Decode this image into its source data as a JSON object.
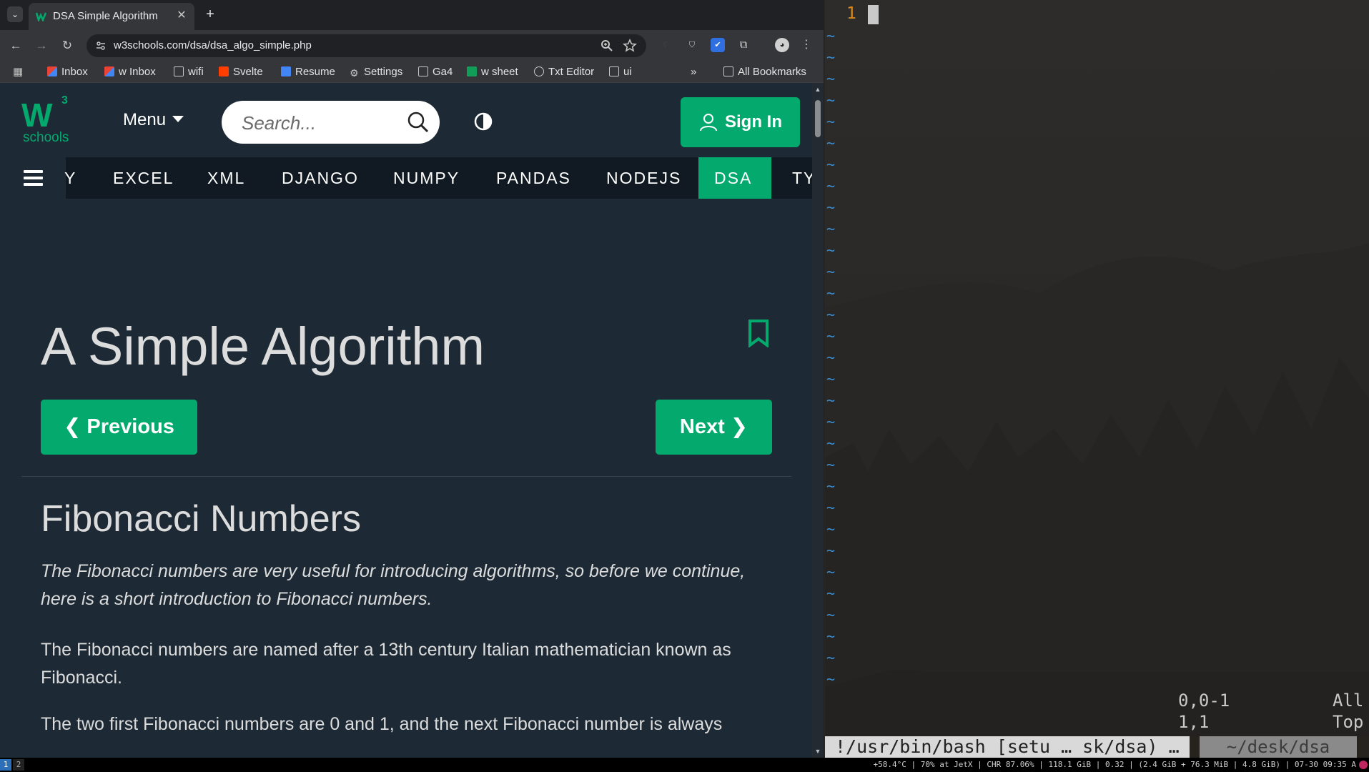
{
  "browser": {
    "tab": {
      "title": "DSA Simple Algorithm",
      "close_glyph": "✕"
    },
    "new_tab_glyph": "+",
    "tab_menu_glyph": "⌄",
    "nav": {
      "back": "←",
      "forward": "→",
      "reload": "↻"
    },
    "address": {
      "url": "w3schools.com/dsa/dsa_algo_simple.php"
    },
    "bookmarks": [
      {
        "label": "Inbox",
        "icon": "gmail-icon"
      },
      {
        "label": "w Inbox",
        "icon": "gmail-icon"
      },
      {
        "label": "wifi",
        "icon": "folder-icon"
      },
      {
        "label": "Svelte",
        "icon": "svelte-icon"
      },
      {
        "label": "Resume",
        "icon": "docs-icon"
      },
      {
        "label": "Settings",
        "icon": "gear-icon"
      },
      {
        "label": "Ga4",
        "icon": "folder-icon"
      },
      {
        "label": "w sheet",
        "icon": "sheets-icon"
      },
      {
        "label": "Txt Editor",
        "icon": "globe-icon"
      },
      {
        "label": "ui",
        "icon": "folder-icon"
      }
    ],
    "bookmarks_overflow": "»",
    "all_bookmarks": "All Bookmarks"
  },
  "page": {
    "logo": {
      "mark": "W",
      "superscript": "3",
      "word": "schools"
    },
    "menu_label": "Menu",
    "search_placeholder": "Search...",
    "signin_label": "Sign In",
    "subnav": [
      "Y",
      "EXCEL",
      "XML",
      "DJANGO",
      "NUMPY",
      "PANDAS",
      "NODEJS",
      "DSA",
      "TY"
    ],
    "subnav_active": "DSA",
    "title": "A Simple Algorithm",
    "prev_label": "❮ Previous",
    "next_label": "Next ❯",
    "section_title": "Fibonacci Numbers",
    "intro_italic": "The Fibonacci numbers are very useful for introducing algorithms, so before we continue, here is a short introduction to Fibonacci numbers.",
    "para_named": "The Fibonacci numbers are named after a 13th century Italian mathematician known as Fibonacci.",
    "para_cut": "The two first Fibonacci numbers are 0 and 1, and the next Fibonacci number is always"
  },
  "vim": {
    "line_number": "1",
    "ruler_pos_a": "0,0-1",
    "ruler_pos_b": "1,1",
    "ruler_view_a": "All",
    "ruler_view_b": "Top",
    "status_left": "!/usr/bin/bash [setu … sk/dsa) …",
    "status_right": "~/desk/dsa"
  },
  "taskbar": {
    "workspaces": [
      "1",
      "2"
    ],
    "sysinfo": "+58.4°C | 70% at JetX | CHR 87.06% | 118.1 GiB | 0.32 | (2.4 GiB + 76.3 MiB | 4.8 GiB) | 07-30 09:35 A"
  },
  "colors": {
    "accent": "#04aa6d",
    "page_bg": "#1d2a35",
    "vim_tilde": "#3a8fd4",
    "vim_linenr": "#d7891a"
  }
}
